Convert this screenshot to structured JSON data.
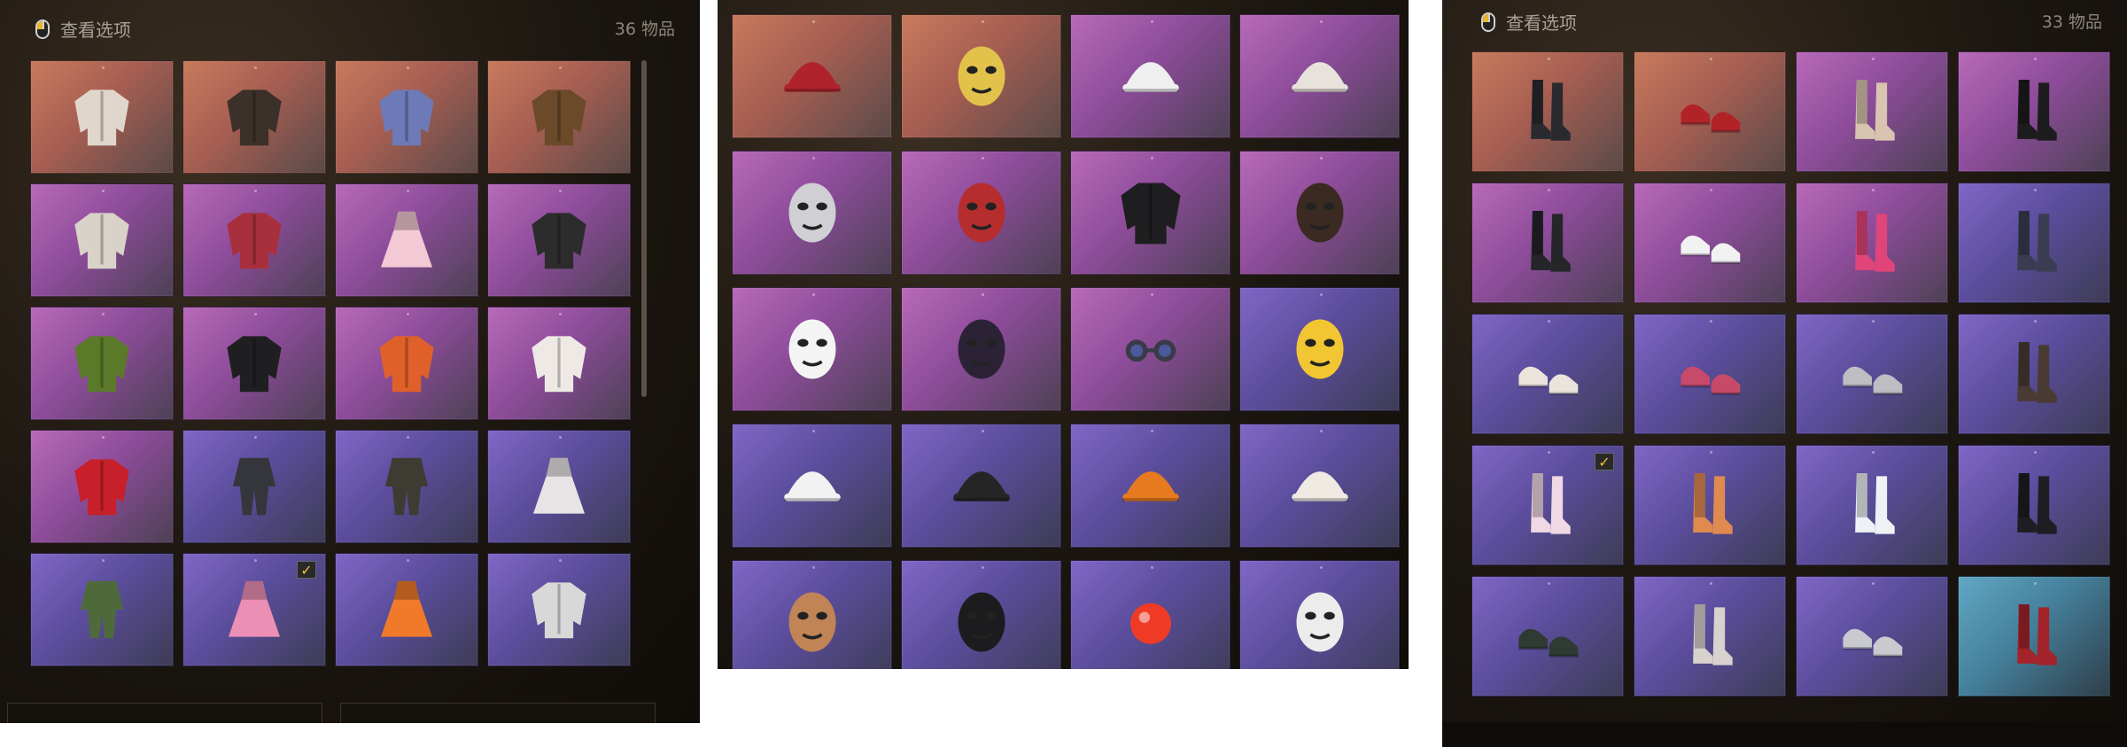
{
  "panels": [
    {
      "id": "outfits",
      "header": {
        "view_label": "查看选项",
        "count": "36 物品"
      },
      "items": [
        {
          "name": "jacket",
          "bg": "orange",
          "icon": "leather-jacket-icon",
          "color": "#e0d6cc"
        },
        {
          "name": "long-coat",
          "bg": "orange",
          "icon": "trench-coat-icon",
          "color": "#3b302a"
        },
        {
          "name": "puffer",
          "bg": "orange",
          "icon": "hooded-jacket-icon",
          "color": "#6c7ab8"
        },
        {
          "name": "fur-coat",
          "bg": "orange",
          "icon": "fur-coat-icon",
          "color": "#6b4a2a"
        },
        {
          "name": "sailor-top",
          "bg": "magenta",
          "icon": "sailor-shirt-icon",
          "color": "#d8d2c8"
        },
        {
          "name": "striped-jacket",
          "bg": "magenta",
          "icon": "striped-jacket-icon",
          "color": "#a8303d"
        },
        {
          "name": "pink-onesie",
          "bg": "magenta",
          "icon": "onesie-icon",
          "color": "#f2c9d4"
        },
        {
          "name": "graffiti-jacket",
          "bg": "magenta",
          "icon": "graffiti-jacket-icon",
          "color": "#2c2c2c"
        },
        {
          "name": "camo-jacket",
          "bg": "magenta",
          "icon": "camo-jacket-icon",
          "color": "#5a7a2a"
        },
        {
          "name": "moto-jacket",
          "bg": "magenta",
          "icon": "moto-jacket-icon",
          "color": "#1f1f22"
        },
        {
          "name": "orange-jacket",
          "bg": "magenta",
          "icon": "windbreaker-icon",
          "color": "#e0602a"
        },
        {
          "name": "white-jacket",
          "bg": "magenta",
          "icon": "white-jacket-icon",
          "color": "#efe9e6"
        },
        {
          "name": "red-armor",
          "bg": "magenta",
          "icon": "armor-vest-icon",
          "color": "#c8202a"
        },
        {
          "name": "suit-gray",
          "bg": "violet",
          "icon": "suit-icon",
          "color": "#35363c"
        },
        {
          "name": "suit-khaki",
          "bg": "violet",
          "icon": "uniform-icon",
          "color": "#3e3c32"
        },
        {
          "name": "white-dress",
          "bg": "violet",
          "icon": "dress-icon",
          "color": "#e8e4e6"
        },
        {
          "name": "green-jumpsuit",
          "bg": "violet",
          "icon": "jumpsuit-icon",
          "color": "#4f6a3a"
        },
        {
          "name": "pink-dress",
          "bg": "violet",
          "icon": "frill-dress-icon",
          "color": "#ec8fb5",
          "checked": true
        },
        {
          "name": "orange-dress",
          "bg": "violet",
          "icon": "maid-dress-icon",
          "color": "#f07a2a"
        },
        {
          "name": "silver-jacket",
          "bg": "violet",
          "icon": "bomber-jacket-icon",
          "color": "#d8d8d8"
        }
      ]
    },
    {
      "id": "headwear",
      "header": null,
      "items": [
        {
          "name": "beret",
          "bg": "orange",
          "icon": "beret-icon",
          "color": "#b0232d"
        },
        {
          "name": "gold-mask",
          "bg": "orange",
          "icon": "mask-icon",
          "color": "#e2c24a"
        },
        {
          "name": "bear-hat",
          "bg": "magenta",
          "icon": "bear-hat-icon",
          "color": "#efefef"
        },
        {
          "name": "beanie-pom",
          "bg": "magenta",
          "icon": "pompom-beanie-icon",
          "color": "#e8e2dc"
        },
        {
          "name": "tv-head",
          "bg": "magenta",
          "icon": "tv-head-icon",
          "color": "#cfcfd4"
        },
        {
          "name": "luchador",
          "bg": "magenta",
          "icon": "luchador-mask-icon",
          "color": "#b52d2d"
        },
        {
          "name": "black-mask",
          "bg": "magenta",
          "icon": "face-cover-icon",
          "color": "#1e1e20"
        },
        {
          "name": "chimp-mask",
          "bg": "magenta",
          "icon": "chimp-mask-icon",
          "color": "#3a2a22"
        },
        {
          "name": "clown-mask",
          "bg": "magenta",
          "icon": "clown-mask-icon",
          "color": "#f4f4f4"
        },
        {
          "name": "mesh-mask",
          "bg": "magenta",
          "icon": "mesh-mask-icon",
          "color": "#2c2236"
        },
        {
          "name": "goggles",
          "bg": "magenta",
          "icon": "goggles-icon",
          "color": "#3a3a48"
        },
        {
          "name": "rooster",
          "bg": "violet",
          "icon": "rooster-mask-icon",
          "color": "#f2c632"
        },
        {
          "name": "cow-cap",
          "bg": "violet",
          "icon": "cow-hat-icon",
          "color": "#f2f2f2"
        },
        {
          "name": "black-cap",
          "bg": "violet",
          "icon": "baseball-cap-icon",
          "color": "#252525"
        },
        {
          "name": "orange-beanie",
          "bg": "violet",
          "icon": "beanie-icon",
          "color": "#e77a1e"
        },
        {
          "name": "cowboy-hat",
          "bg": "violet",
          "icon": "cowboy-hat-icon",
          "color": "#efeae2"
        },
        {
          "name": "wood-mask",
          "bg": "violet",
          "icon": "wood-mask-icon",
          "color": "#c08456"
        },
        {
          "name": "face-mask-black",
          "bg": "violet",
          "icon": "face-mask-icon",
          "color": "#1c1c1e"
        },
        {
          "name": "clown-nose",
          "bg": "violet",
          "icon": "clown-nose-icon",
          "color": "#ef3b26"
        },
        {
          "name": "zebra-mask",
          "bg": "violet",
          "icon": "zebra-mask-icon",
          "color": "#ececec"
        }
      ]
    },
    {
      "id": "footwear",
      "header": {
        "view_label": "查看选项",
        "count": "33 物品"
      },
      "items": [
        {
          "name": "tall-boots",
          "bg": "orange",
          "icon": "thigh-boots-icon",
          "color": "#2a2a2e"
        },
        {
          "name": "red-heels",
          "bg": "orange",
          "icon": "heels-icon",
          "color": "#b22328"
        },
        {
          "name": "fur-boots",
          "bg": "magenta",
          "icon": "fur-boots-icon",
          "color": "#d8c4b0"
        },
        {
          "name": "black-knee-boots",
          "bg": "magenta",
          "icon": "knee-boots-icon",
          "color": "#1c1c1e"
        },
        {
          "name": "ankle-boots",
          "bg": "magenta",
          "icon": "ankle-boots-icon",
          "color": "#25252a"
        },
        {
          "name": "white-sneakers",
          "bg": "magenta",
          "icon": "sneakers-icon",
          "color": "#f2f2f2"
        },
        {
          "name": "pink-lace-boots",
          "bg": "magenta",
          "icon": "lace-boots-icon",
          "color": "#e0457a"
        },
        {
          "name": "outfit-legs",
          "bg": "violet",
          "icon": "leg-outfit-icon",
          "color": "#3a3c52"
        },
        {
          "name": "hi-tops",
          "bg": "violet",
          "icon": "hi-top-sneakers-icon",
          "color": "#eae4dc"
        },
        {
          "name": "flip-flops",
          "bg": "violet",
          "icon": "flip-flops-icon",
          "color": "#c84a6a"
        },
        {
          "name": "gray-sneakers",
          "bg": "violet",
          "icon": "gray-sneakers-icon",
          "color": "#bdbdc2"
        },
        {
          "name": "stockings",
          "bg": "violet",
          "icon": "stockings-icon",
          "color": "#4a3a34"
        },
        {
          "name": "pink-socks",
          "bg": "violet",
          "icon": "socks-icon",
          "color": "#f0d8e4",
          "checked": true
        },
        {
          "name": "orange-leggings",
          "bg": "violet",
          "icon": "leggings-icon",
          "color": "#e08a50"
        },
        {
          "name": "white-boots",
          "bg": "violet",
          "icon": "white-boots-icon",
          "color": "#eef2f6"
        },
        {
          "name": "black-boots",
          "bg": "violet",
          "icon": "combat-boots-icon",
          "color": "#1e1e22"
        },
        {
          "name": "green-shoes",
          "bg": "violet",
          "icon": "shoes-icon",
          "color": "#2e3a32"
        },
        {
          "name": "print-boots",
          "bg": "violet",
          "icon": "printed-boots-icon",
          "color": "#d8d2ce"
        },
        {
          "name": "silver-sneakers",
          "bg": "violet",
          "icon": "silver-sneakers-icon",
          "color": "#c8cad0"
        },
        {
          "name": "red-boots",
          "bg": "cyan",
          "icon": "cowboy-boots-icon",
          "color": "#a2232a"
        }
      ]
    }
  ]
}
